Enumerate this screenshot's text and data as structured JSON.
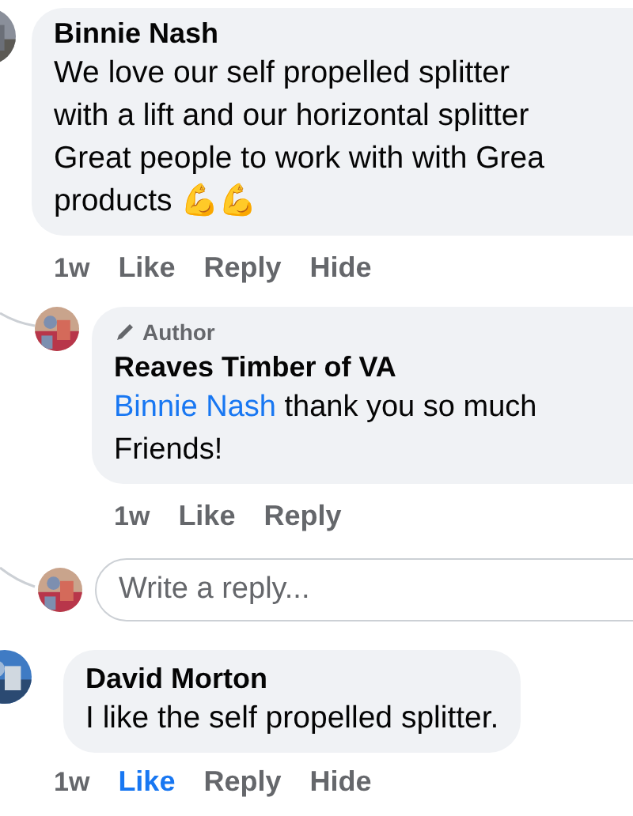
{
  "comments": [
    {
      "author": "Binnie Nash",
      "lines": [
        {
          "text": "We love our self propelled splitter"
        },
        {
          "text": "with a lift and our horizontal splitter"
        },
        {
          "text": "Great people to work with with Grea"
        },
        {
          "text": "products 💪💪"
        }
      ],
      "time": "1w",
      "actions": [
        {
          "label": "Like",
          "active": false
        },
        {
          "label": "Reply",
          "active": false
        },
        {
          "label": "Hide",
          "active": false
        }
      ],
      "replies": [
        {
          "author": "Reaves Timber of VA",
          "badge": "Author",
          "mention": "Binnie Nash",
          "lines": [
            {
              "text": "thank you so much"
            },
            {
              "text": "Friends!"
            }
          ],
          "time": "1w",
          "actions": [
            {
              "label": "Like",
              "active": false
            },
            {
              "label": "Reply",
              "active": false
            }
          ]
        }
      ],
      "reply_box": {
        "placeholder": "Write a reply..."
      }
    },
    {
      "author": "David Morton",
      "lines": [
        {
          "text": "I like the self propelled splitter."
        }
      ],
      "time": "1w",
      "actions": [
        {
          "label": "Like",
          "active": true
        },
        {
          "label": "Reply",
          "active": false
        },
        {
          "label": "Hide",
          "active": false
        }
      ]
    }
  ]
}
